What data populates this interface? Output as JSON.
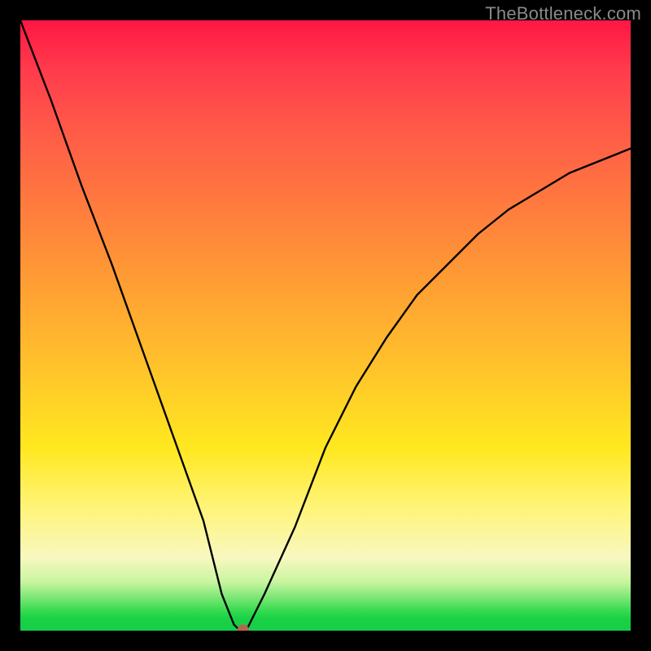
{
  "watermark": "TheBottleneck.com",
  "chart_data": {
    "type": "line",
    "title": "",
    "xlabel": "",
    "ylabel": "",
    "xlim": [
      0,
      100
    ],
    "ylim": [
      0,
      100
    ],
    "grid": false,
    "axes_visible": false,
    "gradient_stops": [
      {
        "offset": 0,
        "color": "#ff1744"
      },
      {
        "offset": 18,
        "color": "#ff5a48"
      },
      {
        "offset": 44,
        "color": "#ffa033"
      },
      {
        "offset": 70,
        "color": "#ffe81f"
      },
      {
        "offset": 88,
        "color": "#f8f8c0"
      },
      {
        "offset": 95,
        "color": "#6ee46e"
      },
      {
        "offset": 100,
        "color": "#13cf47"
      }
    ],
    "series": [
      {
        "name": "bottleneck-curve",
        "x": [
          0,
          5,
          10,
          15,
          20,
          25,
          30,
          33,
          35,
          36,
          37,
          40,
          45,
          50,
          55,
          60,
          65,
          70,
          75,
          80,
          85,
          90,
          95,
          100
        ],
        "values": [
          100,
          87,
          73,
          60,
          46,
          32,
          18,
          6,
          1,
          0,
          0,
          6,
          17,
          30,
          40,
          48,
          55,
          60,
          65,
          69,
          72,
          75,
          77,
          79
        ]
      }
    ],
    "marker": {
      "x": 36.5,
      "y": 0,
      "color": "#b6654d",
      "radius": 1.0
    }
  }
}
